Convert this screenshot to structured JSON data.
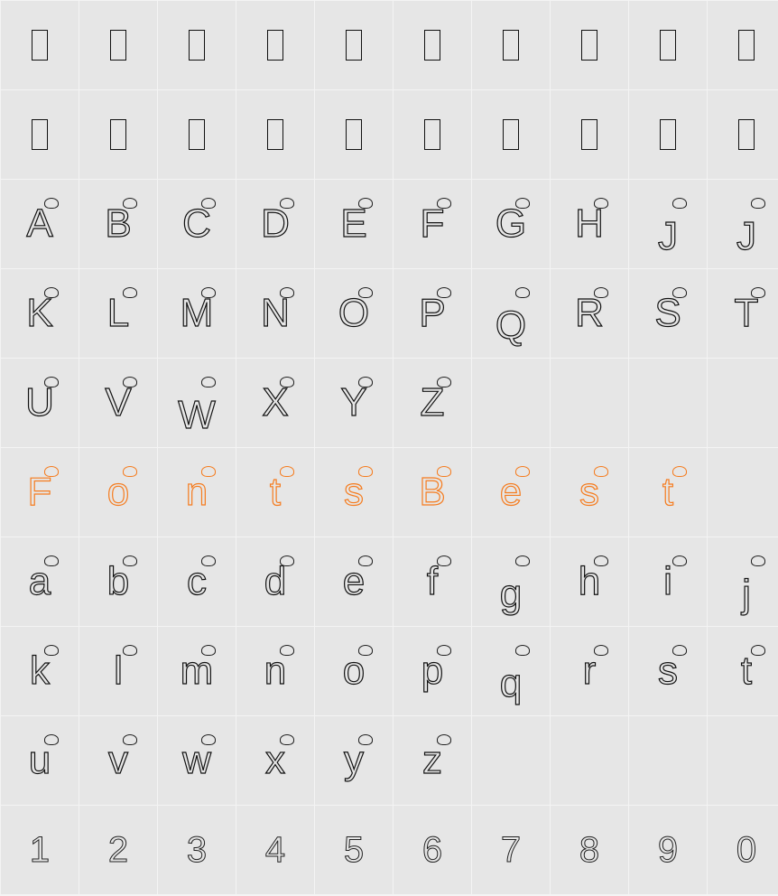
{
  "rows": [
    [
      "notdef",
      "notdef",
      "notdef",
      "notdef",
      "notdef",
      "notdef",
      "notdef",
      "notdef",
      "notdef",
      "notdef"
    ],
    [
      "notdef",
      "notdef",
      "notdef",
      "notdef",
      "notdef",
      "notdef",
      "notdef",
      "notdef",
      "notdef",
      "notdef"
    ],
    [
      "A",
      "B",
      "C",
      "D",
      "E",
      "F",
      "G",
      "H",
      "J",
      "J"
    ],
    [
      "K",
      "L",
      "M",
      "N",
      "O",
      "P",
      "Q",
      "R",
      "S",
      "T"
    ],
    [
      "U",
      "V",
      "W",
      "X",
      "Y",
      "Z",
      "",
      "",
      "",
      ""
    ],
    [
      "F",
      "o",
      "n",
      "t",
      "s",
      "B",
      "e",
      "s",
      "t",
      ""
    ],
    [
      "a",
      "b",
      "c",
      "d",
      "e",
      "f",
      "g",
      "h",
      "i",
      "j"
    ],
    [
      "k",
      "l",
      "m",
      "n",
      "o",
      "p",
      "q",
      "r",
      "s",
      "t"
    ],
    [
      "u",
      "v",
      "w",
      "x",
      "y",
      "z",
      "",
      "",
      "",
      ""
    ],
    [
      "1",
      "2",
      "3",
      "4",
      "5",
      "6",
      "7",
      "8",
      "9",
      "0"
    ]
  ],
  "accent_row_index": 5,
  "digit_row_index": 9,
  "colors": {
    "cell_background": "#e6e6e6",
    "grid_line": "#f4f4f4",
    "glyph_outline": "#111111",
    "accent_outline": "#f57c1f"
  },
  "icons": {
    "missing_glyph": "notdef-box-icon",
    "animal_decoration": "animal-doodle-icon"
  }
}
